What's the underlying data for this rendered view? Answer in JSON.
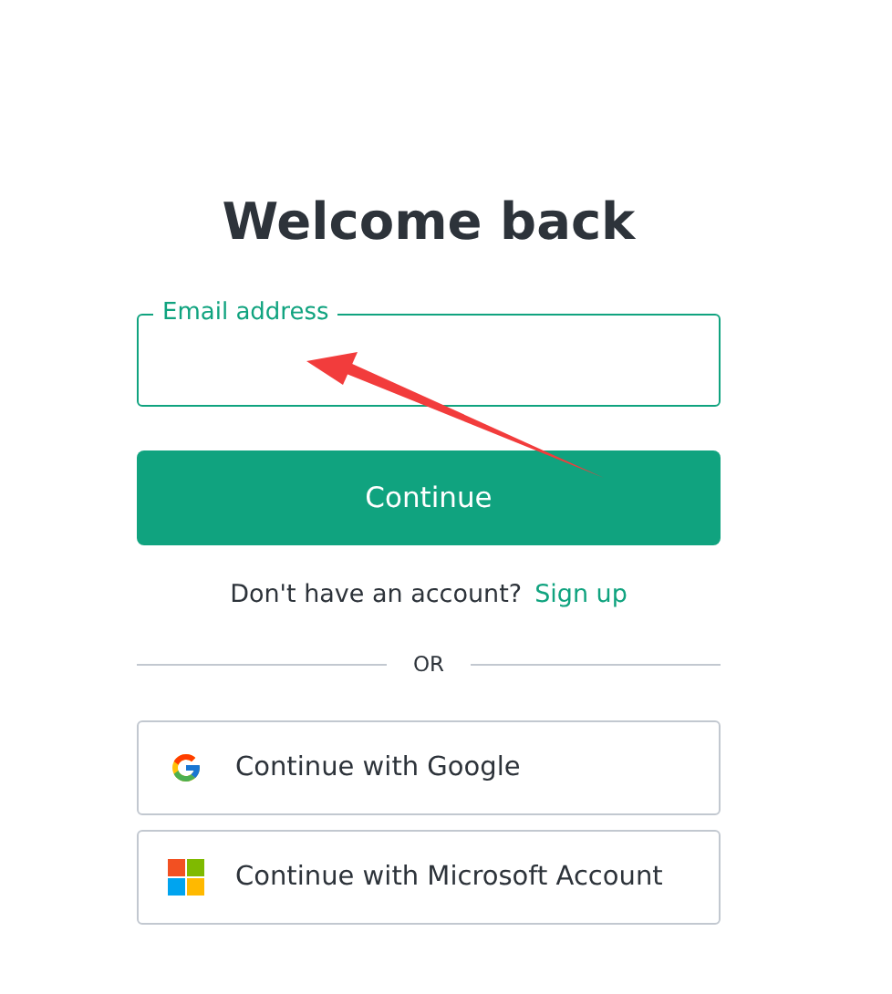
{
  "title": "Welcome back",
  "email_field": {
    "label": "Email address"
  },
  "continue_button": "Continue",
  "signup_prompt": {
    "text": "Don't have an account?",
    "link": "Sign up"
  },
  "divider": "OR",
  "social_buttons": [
    {
      "kind": "google",
      "label": "Continue with Google"
    },
    {
      "kind": "microsoft",
      "label": "Continue with Microsoft Account"
    }
  ],
  "annotation": {
    "kind": "arrow"
  }
}
